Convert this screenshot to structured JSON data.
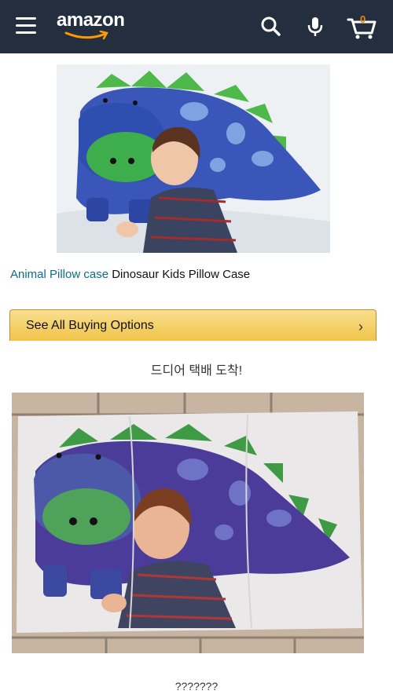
{
  "header": {
    "logo": "amazon",
    "cart_count": "0",
    "icons": [
      "menu-icon",
      "search-icon",
      "microphone-icon",
      "cart-icon"
    ],
    "background": "#232f3e",
    "logo_smile_color": "#f90"
  },
  "product": {
    "category_link": "Animal Pillow case",
    "name": "Dinosaur Kids Pillow Case",
    "link_color": "#0f6c8a"
  },
  "buy_button": {
    "label": "See All Buying Options",
    "chevron": "›"
  },
  "captions": {
    "arrived": "드디어 택배 도착!",
    "question": "???????"
  },
  "images": {
    "listing_photo": "product-listing-photo",
    "delivered_photo": "delivered-item-photo"
  }
}
